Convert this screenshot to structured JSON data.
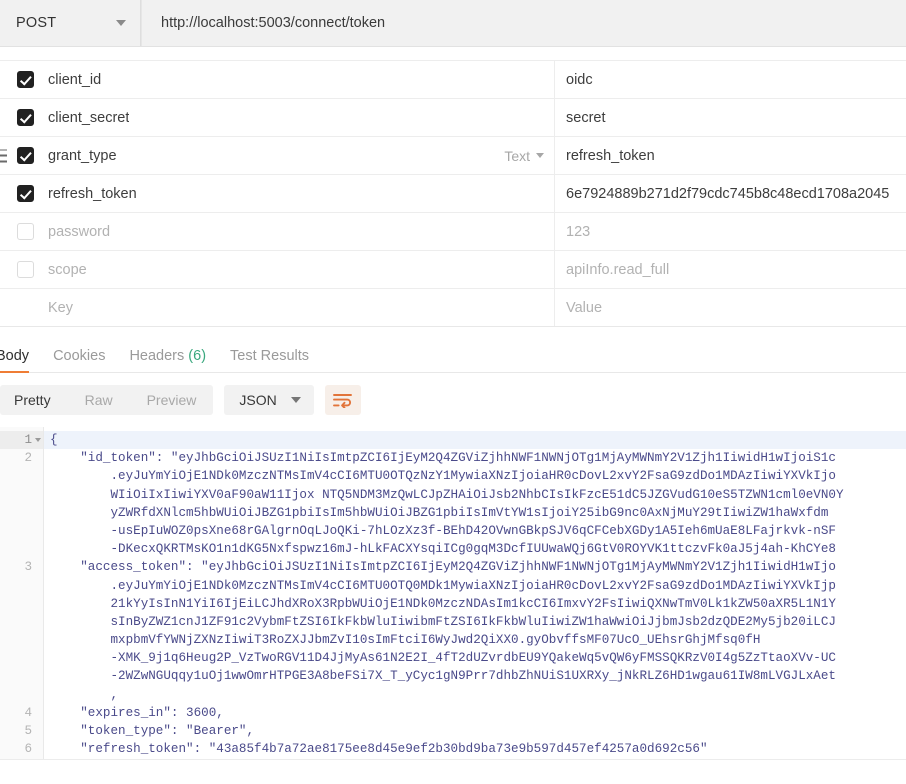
{
  "request_bar": {
    "method": "POST",
    "method_caret": "chevron-down-icon",
    "url": "http://localhost:5003/connect/token"
  },
  "form_table": {
    "key_placeholder": "Key",
    "value_placeholder": "Value",
    "type_dropdown_label": "Text",
    "rows": [
      {
        "checked": true,
        "key": "client_id",
        "value": "oidc",
        "key_muted": false,
        "value_muted": false,
        "show_type": false,
        "show_drag": false
      },
      {
        "checked": true,
        "key": "client_secret",
        "value": "secret",
        "key_muted": false,
        "value_muted": false,
        "show_type": false,
        "show_drag": false
      },
      {
        "checked": true,
        "key": "grant_type",
        "value": "refresh_token",
        "key_muted": false,
        "value_muted": false,
        "show_type": true,
        "show_drag": true
      },
      {
        "checked": true,
        "key": "refresh_token",
        "value": "6e7924889b271d2f79cdc745b8c48ecd1708a2045",
        "key_muted": false,
        "value_muted": false,
        "show_type": false,
        "show_drag": false
      },
      {
        "checked": false,
        "key": "password",
        "value": "123",
        "key_muted": true,
        "value_muted": true,
        "show_type": false,
        "show_drag": false
      },
      {
        "checked": false,
        "key": "scope",
        "value": "apiInfo.read_full",
        "key_muted": true,
        "value_muted": true,
        "show_type": false,
        "show_drag": false
      },
      {
        "checked": null,
        "key": "Key",
        "value": "Value",
        "key_muted": true,
        "value_muted": true,
        "show_type": false,
        "show_drag": false
      }
    ]
  },
  "response": {
    "tabs": [
      {
        "label": "Body",
        "active": true,
        "count": null
      },
      {
        "label": "Cookies",
        "active": false,
        "count": null
      },
      {
        "label": "Headers",
        "active": false,
        "count": "(6)"
      },
      {
        "label": "Test Results",
        "active": false,
        "count": null
      }
    ],
    "format_modes": [
      {
        "label": "Pretty",
        "active": true
      },
      {
        "label": "Raw",
        "active": false
      },
      {
        "label": "Preview",
        "active": false
      }
    ],
    "language": "JSON",
    "language_caret": "chevron-down-icon",
    "wrap_button_icon": "text-wrap-icon",
    "accent_color": "#ef7d35",
    "count_color": "#3aa87e"
  },
  "code": {
    "lines": [
      {
        "num": "1",
        "foldable": true,
        "highlight": true,
        "text": "{"
      },
      {
        "num": "2",
        "foldable": false,
        "highlight": false,
        "text": "    \"id_token\": \"eyJhbGciOiJSUzI1NiIsImtpZCI6IjEyM2Q4ZGViZjhhNWF1NWNjOTg1MjAyMWNmY2V1Zjh1IiwidH1wIjoiS1c"
      },
      {
        "num": "",
        "foldable": false,
        "highlight": false,
        "text": "        .eyJuYmYiOjE1NDk0MzczNTMsImV4cCI6MTU0OTQzNzY1MywiaXNzIjoiaHR0cDovL2xvY2FsaG9zdDo1MDAzIiwiYXVkIjo"
      },
      {
        "num": "",
        "foldable": false,
        "highlight": false,
        "text": "        WIiOiIxIiwiYXV0aF90aW11Ijox NTQ5NDM3MzQwLCJpZHAiOiJsb2NhbCIsIkFzcE51dC5JZGVudG10eS5TZWN1cml0eVN0Y"
      },
      {
        "num": "",
        "foldable": false,
        "highlight": false,
        "text": "        yZWRfdXNlcm5hbWUiOiJBZG1pbiIsIm5hbWUiOiJBZG1pbiIsImVtYW1sIjoiY25ibG9nc0AxNjMuY29tIiwiZW1haWxfdm"
      },
      {
        "num": "",
        "foldable": false,
        "highlight": false,
        "text": "        -usEpIuWOZ0psXne68rGAlgrnOqLJoQKi-7hLOzXz3f-BEhD42OVwnGBkpSJV6qCFCebXGDy1A5Ieh6mUaE8LFajrkvk-nSF"
      },
      {
        "num": "",
        "foldable": false,
        "highlight": false,
        "text": "        -DKecxQKRTMsKO1n1dKG5Nxfspwz16mJ-hLkFACXYsqiICg0gqM3DcfIUUwaWQj6GtV0ROYVK1ttczvFk0aJ5j4ah-KhCYe8"
      },
      {
        "num": "3",
        "foldable": false,
        "highlight": false,
        "text": "    \"access_token\": \"eyJhbGciOiJSUzI1NiIsImtpZCI6IjEyM2Q4ZGViZjhhNWF1NWNjOTg1MjAyMWNmY2V1Zjh1IiwidH1wIjo"
      },
      {
        "num": "",
        "foldable": false,
        "highlight": false,
        "text": "        .eyJuYmYiOjE1NDk0MzczNTMsImV4cCI6MTU0OTQ0MDk1MywiaXNzIjoiaHR0cDovL2xvY2FsaG9zdDo1MDAzIiwiYXVkIjp"
      },
      {
        "num": "",
        "foldable": false,
        "highlight": false,
        "text": "        21kYyIsInN1YiI6IjEiLCJhdXRoX3RpbWUiOjE1NDk0MzczNDAsIm1kcCI6ImxvY2FsIiwiQXNwTmV0Lk1kZW50aXR5L1N1Y"
      },
      {
        "num": "",
        "foldable": false,
        "highlight": false,
        "text": "        sInByZWZ1cnJ1ZF91c2VybmFtZSI6IkFkbWluIiwibmFtZSI6IkFkbWluIiwiZW1haWwiOiJjbmJsb2dzQDE2My5jb20iLCJ"
      },
      {
        "num": "",
        "foldable": false,
        "highlight": false,
        "text": "        mxpbmVfYWNjZXNzIiwiT3RoZXJJbmZvI10sImFtciI6WyJwd2QiXX0.gyObvffsMF07UcO_UEhsrGhjMfsq0fH"
      },
      {
        "num": "",
        "foldable": false,
        "highlight": false,
        "text": "        -XMK_9j1q6Heug2P_VzTwoRGV11D4JjMyAs61N2E2I_4fT2dUZvrdbEU9YQakeWq5vQW6yFMSSQKRzV0I4g5ZzTtaoXVv-UC"
      },
      {
        "num": "",
        "foldable": false,
        "highlight": false,
        "text": "        -2WZwNGUqqy1uOj1wwOmrHTPGE3A8beFSi7X_T_yCyc1gN9Prr7dhbZhNUiS1UXRXy_jNkRLZ6HD1wgau61IW8mLVGJLxAet"
      },
      {
        "num": "",
        "foldable": false,
        "highlight": false,
        "text": "        ,"
      },
      {
        "num": "4",
        "foldable": false,
        "highlight": false,
        "text": "    \"expires_in\": 3600,"
      },
      {
        "num": "5",
        "foldable": false,
        "highlight": false,
        "text": "    \"token_type\": \"Bearer\","
      },
      {
        "num": "6",
        "foldable": false,
        "highlight": false,
        "text": "    \"refresh_token\": \"43a85f4b7a72ae8175ee8d45e9ef2b30bd9ba73e9b597d457ef4257a0d692c56\""
      }
    ]
  }
}
